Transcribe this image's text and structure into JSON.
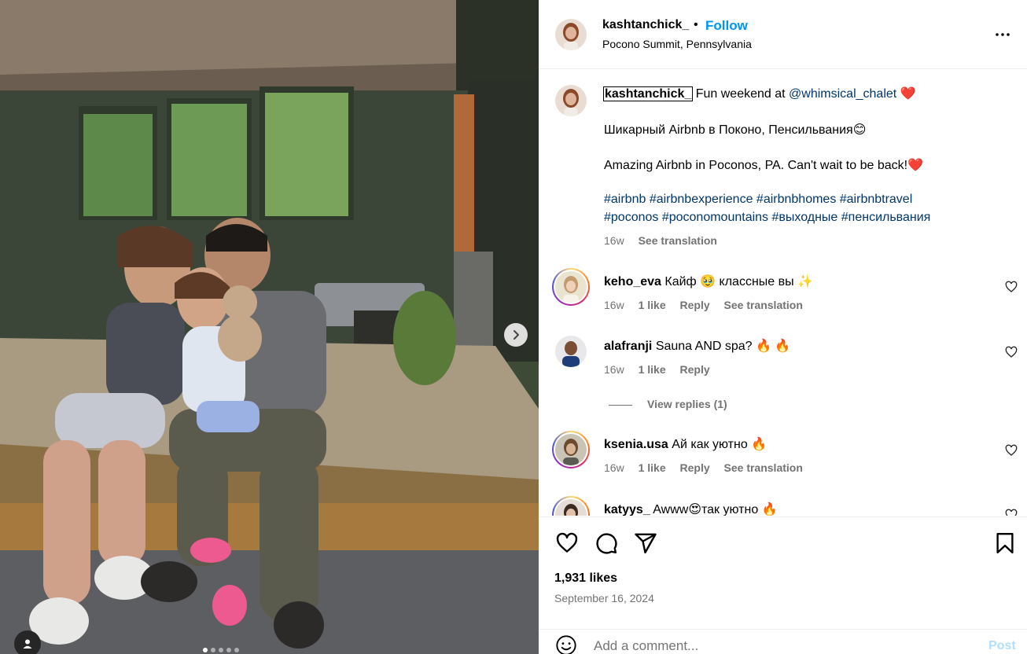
{
  "post": {
    "username": "kashtanchick_",
    "separator": "•",
    "follow_label": "Follow",
    "location": "Pocono Summit, Pennsylvania"
  },
  "caption": {
    "username": "kashtanchick_",
    "line1_text": "Fun weekend at",
    "line1_mention": "@whimsical_chalet",
    "line1_emoji": "❤️",
    "line2": "Шикарный Airbnb в Поконо, Пенсильвания😊",
    "line3": "Amazing Airbnb in Poconos, PA. Can't wait to be back!❤️",
    "hashtags_line1": "#airbnb #airbnbexperience #airbnbhomes #airbnbtravel",
    "hashtags_line2": "#poconos #poconomountains #выходные #пенсильвания",
    "time": "16w",
    "see_translation": "See translation"
  },
  "comments": [
    {
      "username": "keho_eva",
      "text": "Кайф 🥹 классные вы ✨",
      "time": "16w",
      "likes": "1 like",
      "reply": "Reply",
      "see_translation": "See translation"
    },
    {
      "username": "alafranji",
      "text": "Sauna AND spa? 🔥 🔥",
      "time": "16w",
      "likes": "1 like",
      "reply": "Reply",
      "view_replies": "View replies (1)"
    },
    {
      "username": "ksenia.usa",
      "text": "Ай как уютно 🔥",
      "time": "16w",
      "likes": "1 like",
      "reply": "Reply",
      "see_translation": "See translation"
    },
    {
      "username": "katyys_",
      "text": "Awww😍так уютно 🔥"
    }
  ],
  "actions": {
    "likes": "1,931 likes",
    "date": "September 16, 2024"
  },
  "add_comment": {
    "placeholder": "Add a comment...",
    "post_label": "Post"
  },
  "colors": {
    "follow": "#0095f6",
    "hashtag": "#00376b",
    "muted": "#737373"
  },
  "icons": [
    "more-icon",
    "heart-icon",
    "comment-icon",
    "share-icon",
    "bookmark-icon",
    "emoji-icon",
    "next-arrow-icon",
    "user-tag-icon"
  ]
}
